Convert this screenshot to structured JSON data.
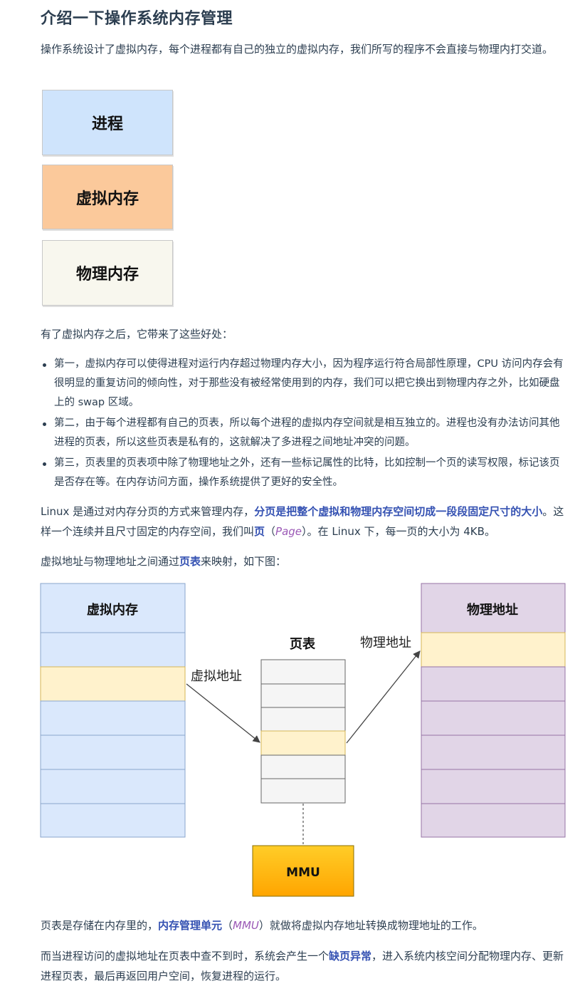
{
  "heading": "介绍一下操作系统内存管理",
  "intro": "操作系统设计了虚拟内存，每个进程都有自己的独立的虚拟内存，我们所写的程序不会直接与物理内打交道。",
  "layers": {
    "process": "进程",
    "virtual_memory": "虚拟内存",
    "physical_memory": "物理内存"
  },
  "benefits_intro": "有了虚拟内存之后，它带来了这些好处：",
  "benefits": [
    "第一，虚拟内存可以使得进程对运行内存超过物理内存大小，因为程序运行符合局部性原理，CPU 访问内存会有很明显的重复访问的倾向性，对于那些没有被经常使用到的内存，我们可以把它换出到物理内存之外，比如硬盘上的 swap 区域。",
    "第二，由于每个进程都有自己的页表，所以每个进程的虚拟内存空间就是相互独立的。进程也没有办法访问其他进程的页表，所以这些页表是私有的，这就解决了多进程之间地址冲突的问题。",
    "第三，页表里的页表项中除了物理地址之外，还有一些标记属性的比特，比如控制一个页的读写权限，标记该页是否存在等。在内存访问方面，操作系统提供了更好的安全性。"
  ],
  "paging": {
    "p1": "Linux 是通过对内存分页的方式来管理内存，",
    "strong1": "分页是把整个虚拟和物理内存空间切成一段段固定尺寸的大小",
    "p2": "。这样一个连续并且尺寸固定的内存空间，我们叫",
    "strong2": "页",
    "p3": "（",
    "em1": "Page",
    "p4": "）。在 Linux 下，每一页的大小为 4KB。"
  },
  "mapping": {
    "p1": "虚拟地址与物理地址之间通过",
    "strong1": "页表",
    "p2": "来映射，如下图："
  },
  "diagram": {
    "virtual_memory_title": "虚拟内存",
    "page_table_title": "页表",
    "physical_address_title": "物理地址",
    "virtual_address_label": "虚拟地址",
    "physical_address_label": "物理地址",
    "mmu_label": "MMU",
    "colors": {
      "virtual": "#dae8fc",
      "highlight": "#fff2cc",
      "physical": "#e1d5e7",
      "table": "#f5f5f5",
      "mmu": "#ffb000"
    }
  },
  "mmu_para": {
    "p1": "页表是存储在内存里的，",
    "strong1": "内存管理单元",
    "p2": "（",
    "em1": "MMU",
    "p3": "）就做将虚拟内存地址转换成物理地址的工作。"
  },
  "fault_para": {
    "p1": "而当进程访问的虚拟地址在页表中查不到时，系统会产生一个",
    "strong1": "缺页异常",
    "p2": "，进入系统内核空间分配物理内存、更新进程页表，最后再返回用户空间，恢复进程的运行。"
  }
}
